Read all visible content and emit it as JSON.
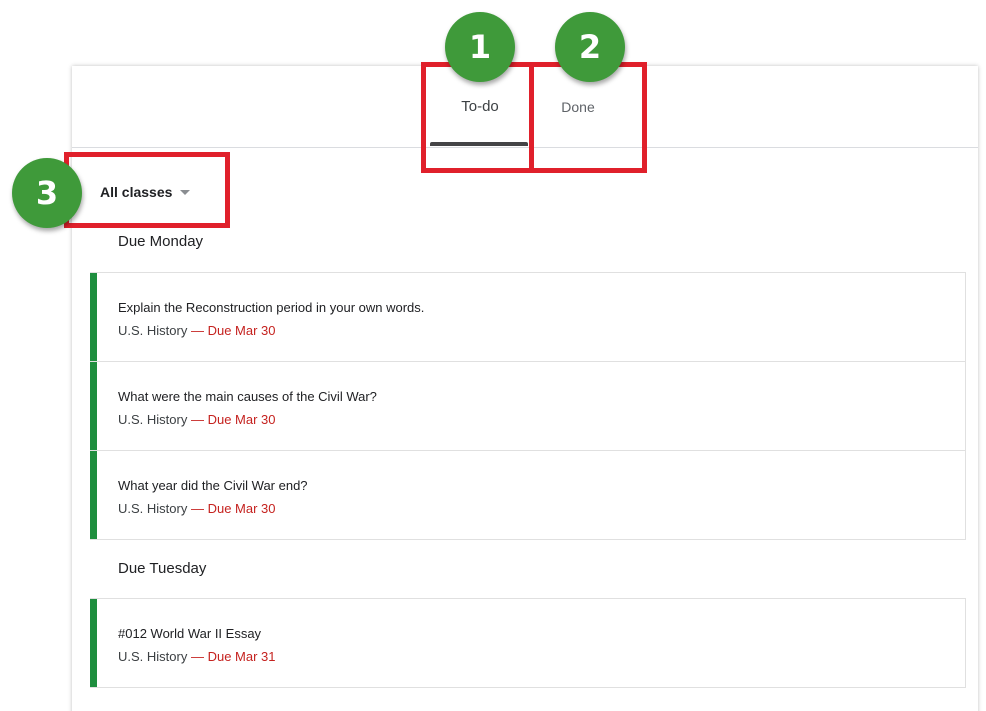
{
  "tabs": {
    "todo_label": "To-do",
    "done_label": "Done"
  },
  "filter": {
    "selected": "All classes"
  },
  "groups": [
    {
      "heading": "Due Monday",
      "items": [
        {
          "title": "Explain the Reconstruction period in your own words.",
          "class": "U.S. History",
          "separator": "—",
          "due": "Due Mar 30"
        },
        {
          "title": "What were the main causes of the Civil War?",
          "class": "U.S. History",
          "separator": "—",
          "due": "Due Mar 30"
        },
        {
          "title": "What year did the Civil War end?",
          "class": "U.S. History",
          "separator": "—",
          "due": "Due Mar 30"
        }
      ]
    },
    {
      "heading": "Due Tuesday",
      "items": [
        {
          "title": "#012 World War II Essay",
          "class": "U.S. History",
          "separator": "—",
          "due": "Due Mar 31"
        }
      ]
    }
  ],
  "badges": [
    "1",
    "2",
    "3"
  ],
  "colors": {
    "accent": "#1e8e3e",
    "due": "#c5221f",
    "highlight": "#e0202b",
    "badge": "#3f9a3a"
  }
}
